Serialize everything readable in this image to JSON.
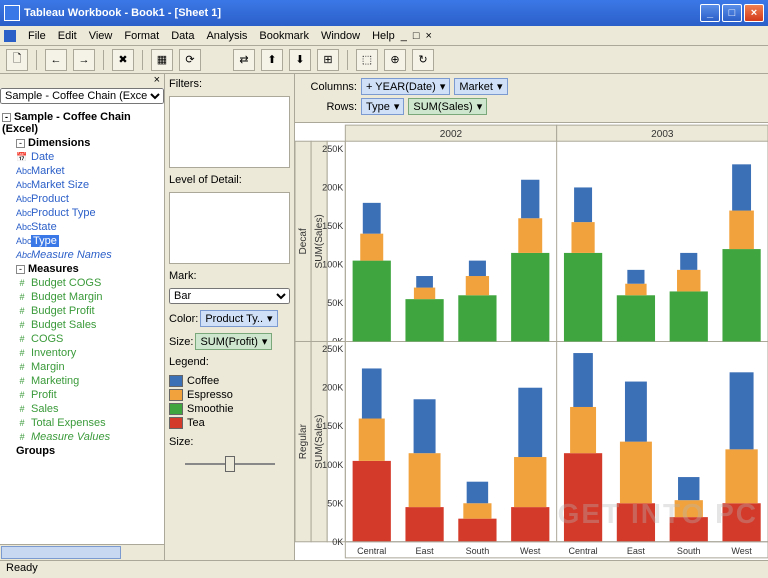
{
  "window": {
    "title": "Tableau Workbook - Book1 - [Sheet 1]"
  },
  "menu": {
    "file": "File",
    "edit": "Edit",
    "view": "View",
    "format": "Format",
    "data": "Data",
    "analysis": "Analysis",
    "bookmark": "Bookmark",
    "window": "Window",
    "help": "Help"
  },
  "datasource": {
    "selected": "Sample - Coffee Chain (Excel)",
    "label": "Sample - Coffee Chain (Excel)"
  },
  "tree": {
    "dimensions_hdr": "Dimensions",
    "dims": {
      "date": "Date",
      "market": "Market",
      "market_size": "Market Size",
      "product": "Product",
      "product_type": "Product Type",
      "state": "State",
      "type": "Type",
      "measure_names": "Measure Names"
    },
    "measures_hdr": "Measures",
    "meas": {
      "budget_cogs": "Budget COGS",
      "budget_margin": "Budget Margin",
      "budget_profit": "Budget Profit",
      "budget_sales": "Budget Sales",
      "cogs": "COGS",
      "inventory": "Inventory",
      "margin": "Margin",
      "marketing": "Marketing",
      "profit": "Profit",
      "sales": "Sales",
      "total_expenses": "Total Expenses",
      "measure_values": "Measure Values"
    },
    "groups_hdr": "Groups"
  },
  "mid": {
    "filters": "Filters:",
    "lod": "Level of Detail:",
    "mark": "Mark:",
    "mark_value": "Bar",
    "color": "Color:",
    "color_value": "Product Ty..",
    "size": "Size:",
    "size_value": "SUM(Profit)",
    "legend": "Legend:",
    "legend_items": {
      "coffee": "Coffee",
      "espresso": "Espresso",
      "smoothie": "Smoothie",
      "tea": "Tea"
    },
    "size2": "Size:"
  },
  "shelves": {
    "columns": "Columns:",
    "rows": "Rows:",
    "col_pills": {
      "year": "+ YEAR(Date)",
      "market": "Market"
    },
    "row_pills": {
      "type": "Type",
      "sales": "SUM(Sales)"
    }
  },
  "chart_headers": {
    "y2002": "2002",
    "y2003": "2003",
    "decaf": "Decaf",
    "regular": "Regular",
    "sumsales": "SUM(Sales)"
  },
  "axis": {
    "t0": "0K",
    "t50": "50K",
    "t100": "100K",
    "t150": "150K",
    "t200": "200K",
    "t250": "250K"
  },
  "markets": {
    "central": "Central",
    "east": "East",
    "south": "South",
    "west": "West"
  },
  "colors": {
    "coffee": "#3b6fb6",
    "espresso": "#f2a23c",
    "smoothie": "#3fa63f",
    "tea": "#d43a2a"
  },
  "status": "Ready",
  "watermark": "GET INTO PC",
  "chart_data": {
    "type": "bar",
    "xlabel": "",
    "ylabel": "SUM(Sales)",
    "columns": [
      "YEAR(Date)",
      "Market"
    ],
    "rows": [
      "Type",
      "SUM(Sales)"
    ],
    "year": [
      "2002",
      "2003"
    ],
    "market": [
      "Central",
      "East",
      "South",
      "West"
    ],
    "row_panels": [
      "Decaf",
      "Regular"
    ],
    "stacks": [
      "Smoothie",
      "Espresso",
      "Coffee"
    ],
    "ylim": [
      0,
      260000
    ],
    "series": [
      {
        "panel": "Decaf",
        "year": "2002",
        "market": "Central",
        "Smoothie": 105000,
        "Espresso": 35000,
        "Coffee": 40000
      },
      {
        "panel": "Decaf",
        "year": "2002",
        "market": "East",
        "Smoothie": 55000,
        "Espresso": 15000,
        "Coffee": 15000
      },
      {
        "panel": "Decaf",
        "year": "2002",
        "market": "South",
        "Smoothie": 60000,
        "Espresso": 25000,
        "Coffee": 20000
      },
      {
        "panel": "Decaf",
        "year": "2002",
        "market": "West",
        "Smoothie": 115000,
        "Espresso": 45000,
        "Coffee": 50000
      },
      {
        "panel": "Decaf",
        "year": "2003",
        "market": "Central",
        "Smoothie": 115000,
        "Espresso": 40000,
        "Coffee": 45000
      },
      {
        "panel": "Decaf",
        "year": "2003",
        "market": "East",
        "Smoothie": 60000,
        "Espresso": 15000,
        "Coffee": 18000
      },
      {
        "panel": "Decaf",
        "year": "2003",
        "market": "South",
        "Smoothie": 65000,
        "Espresso": 28000,
        "Coffee": 22000
      },
      {
        "panel": "Decaf",
        "year": "2003",
        "market": "West",
        "Smoothie": 120000,
        "Espresso": 50000,
        "Coffee": 60000
      },
      {
        "panel": "Regular",
        "year": "2002",
        "market": "Central",
        "Tea": 105000,
        "Espresso": 55000,
        "Coffee": 65000
      },
      {
        "panel": "Regular",
        "year": "2002",
        "market": "East",
        "Tea": 45000,
        "Espresso": 70000,
        "Coffee": 70000
      },
      {
        "panel": "Regular",
        "year": "2002",
        "market": "South",
        "Tea": 30000,
        "Espresso": 20000,
        "Coffee": 28000
      },
      {
        "panel": "Regular",
        "year": "2002",
        "market": "West",
        "Tea": 45000,
        "Espresso": 65000,
        "Coffee": 90000
      },
      {
        "panel": "Regular",
        "year": "2003",
        "market": "Central",
        "Tea": 115000,
        "Espresso": 60000,
        "Coffee": 70000
      },
      {
        "panel": "Regular",
        "year": "2003",
        "market": "East",
        "Tea": 50000,
        "Espresso": 80000,
        "Coffee": 78000
      },
      {
        "panel": "Regular",
        "year": "2003",
        "market": "South",
        "Tea": 32000,
        "Espresso": 22000,
        "Coffee": 30000
      },
      {
        "panel": "Regular",
        "year": "2003",
        "market": "West",
        "Tea": 50000,
        "Espresso": 70000,
        "Coffee": 100000
      }
    ]
  }
}
